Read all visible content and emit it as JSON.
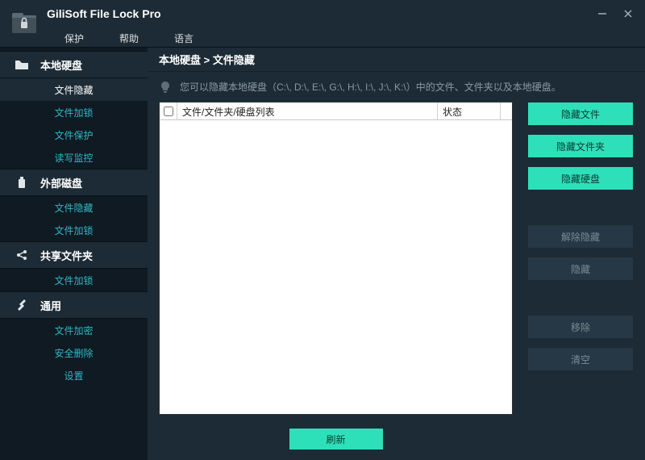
{
  "app": {
    "title": "GiliSoft File Lock Pro"
  },
  "menu": {
    "protect": "保护",
    "help": "帮助",
    "language": "语言"
  },
  "sidebar": {
    "local": {
      "title": "本地硬盘",
      "items": [
        "文件隐藏",
        "文件加锁",
        "文件保护",
        "读写监控"
      ]
    },
    "external": {
      "title": "外部磁盘",
      "items": [
        "文件隐藏",
        "文件加锁"
      ]
    },
    "shared": {
      "title": "共享文件夹",
      "items": [
        "文件加锁"
      ]
    },
    "general": {
      "title": "通用",
      "items": [
        "文件加密",
        "安全删除",
        "设置"
      ]
    }
  },
  "breadcrumb": "本地硬盘 > 文件隐藏",
  "hint": "您可以隐藏本地硬盘（C:\\, D:\\, E:\\, G:\\, H:\\, I:\\, J:\\, K:\\）中的文件、文件夹以及本地硬盘。",
  "columns": {
    "name": "文件/文件夹/硬盘列表",
    "status": "状态"
  },
  "actions": {
    "hideFile": "隐藏文件",
    "hideFolder": "隐藏文件夹",
    "hideDisk": "隐藏硬盘",
    "unhide": "解除隐藏",
    "hide": "隐藏",
    "remove": "移除",
    "clear": "清空"
  },
  "refresh": "刷新"
}
